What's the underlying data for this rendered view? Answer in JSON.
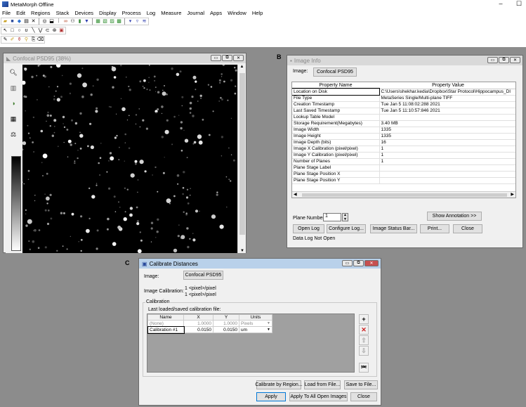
{
  "app": {
    "title": "MetaMorph Offline",
    "minimize": "–",
    "maximize": "☐"
  },
  "menu": [
    "File",
    "Edit",
    "Regions",
    "Stack",
    "Devices",
    "Display",
    "Process",
    "Log",
    "Measure",
    "Journal",
    "Apps",
    "Window",
    "Help"
  ],
  "panels": {
    "b": "B",
    "c": "C"
  },
  "image_window": {
    "title": "Confocal PSD95 (38%)",
    "tools": [
      "zoom-icon",
      "layers-icon",
      "color-icon",
      "ruler-icon",
      "contrast-icon"
    ],
    "scroll_up": "▲",
    "scroll_down": "▼"
  },
  "image_info": {
    "title": "Image Info",
    "image_label": "Image:",
    "image_name": "Confocal PSD95",
    "col_name": "Property Name",
    "col_value": "Property Value",
    "rows": [
      {
        "name": "Location on Disk",
        "value": "C:\\Users\\shekhar.kedia\\Dropbox\\Star Protocol\\Hippocampus_DI"
      },
      {
        "name": "File Type",
        "value": "MetaSeries Single/Multi-plane TIFF"
      },
      {
        "name": "Creation Timestamp",
        "value": "Tue Jan 5 11:08:02:288 2021"
      },
      {
        "name": "Last Saved Timestamp",
        "value": "Tue Jan 5 11:10:57:846 2021"
      },
      {
        "name": "Lookup Table Model",
        "value": ""
      },
      {
        "name": "Storage Requirement(Megabytes)",
        "value": "3.40 MB"
      },
      {
        "name": "Image Width",
        "value": "1335"
      },
      {
        "name": "Image Height",
        "value": "1335"
      },
      {
        "name": "Image Depth (bits)",
        "value": "16"
      },
      {
        "name": "Image X Calibration (pixel/pixel)",
        "value": "1"
      },
      {
        "name": "Image Y Calibration (pixel/pixel)",
        "value": "1"
      },
      {
        "name": "Number of Planes",
        "value": "1"
      },
      {
        "name": "Plane Stage Label",
        "value": ""
      },
      {
        "name": "Plane Stage Position X",
        "value": ""
      },
      {
        "name": "Plane Stage Position Y",
        "value": ""
      }
    ],
    "plane_number_label": "Plane Number:",
    "plane_number_value": "1",
    "show_annotation": "Show Annotation >>",
    "open_log": "Open Log",
    "configure_log": "Configure Log...",
    "image_status_bar": "Image Status Bar...",
    "print": "Print...",
    "close": "Close",
    "status": "Data Log Not Open"
  },
  "calibrate": {
    "title": "Calibrate Distances",
    "image_label": "Image:",
    "image_name": "Confocal PSD95",
    "image_cal_label": "Image Calibration:",
    "image_cal_line1": "1 <pixel>/pixel",
    "image_cal_line2": "1 <pixel>/pixel",
    "group_label": "Calibration",
    "last_loaded": "Last loaded/saved calibration file:",
    "columns": [
      "Name",
      "X",
      "Y",
      "Units"
    ],
    "rows": [
      {
        "name": "(None)",
        "x": "1.0000",
        "y": "1.0000",
        "units": "Pixels"
      },
      {
        "name": "Calibration #1",
        "x": "0.0150",
        "y": "0.0150",
        "units": "um"
      }
    ],
    "calibrate_by_region": "Calibrate by Region...",
    "load_from_file": "Load from File...",
    "save_to_file": "Save to File...",
    "apply": "Apply",
    "apply_all": "Apply To All Open Images",
    "close": "Close"
  },
  "colors": {
    "workspace": "#8c8c8c",
    "active_title": "#b9d1ea",
    "close_red": "#c75050"
  }
}
